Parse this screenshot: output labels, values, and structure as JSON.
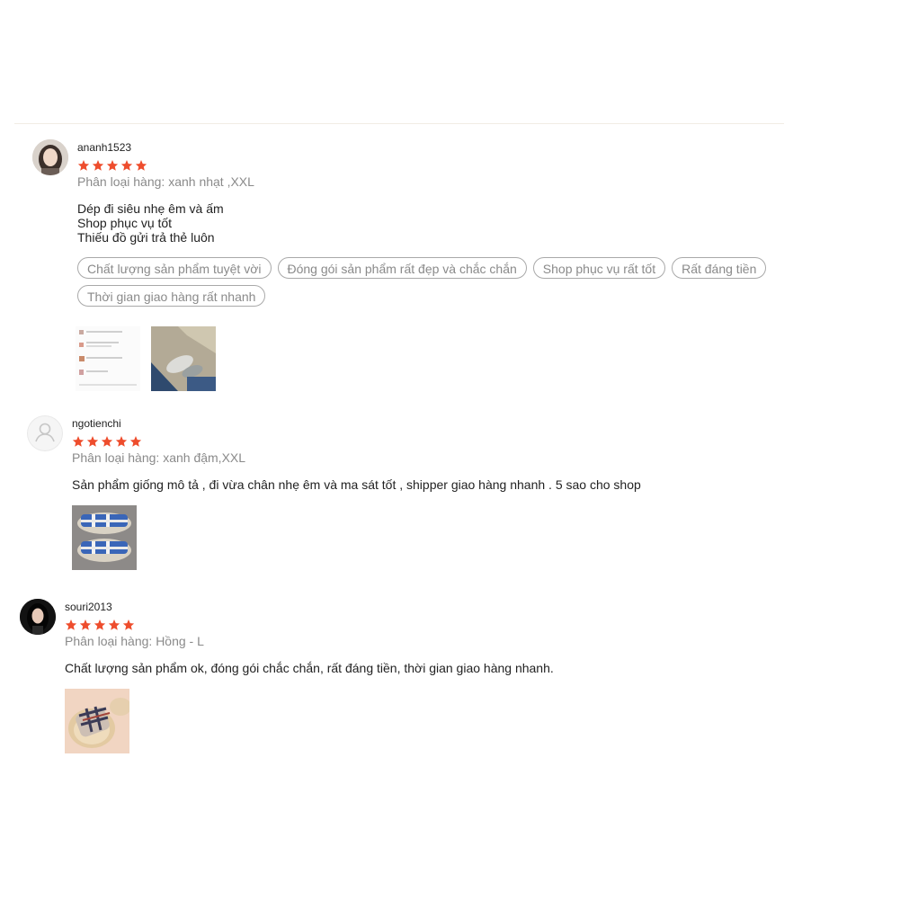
{
  "accent_color": "#ee4d2d",
  "reviews": [
    {
      "username": "ananh1523",
      "rating": 5,
      "variant": "Phân loại hàng: xanh nhạt ,XXL",
      "comment_lines": [
        "Dép đi siêu nhẹ êm và ấm",
        "Shop phục vụ tốt",
        "Thiếu đồ gửi trả thẻ luôn"
      ],
      "tags": [
        "Chất lượng sản phẩm tuyệt vời",
        "Đóng gói sản phẩm rất đẹp và chắc chắn",
        "Shop phục vụ rất tốt",
        "Rất đáng tiền",
        "Thời gian giao hàng rất nhanh"
      ]
    },
    {
      "username": "ngotienchi",
      "rating": 5,
      "variant": "Phân loại hàng: xanh đậm,XXL",
      "comment_lines": [
        "Sản phẩm giống mô tả , đi vừa chân nhẹ êm và ma sát tốt , shipper giao hàng nhanh . 5 sao cho shop"
      ]
    },
    {
      "username": "souri2013",
      "rating": 5,
      "variant": "Phân loại hàng: Hồng - L",
      "comment_lines": [
        "Chất lượng sản phẩm ok, đóng gói chắc chắn, rất đáng tiền, thời gian giao hàng nhanh."
      ]
    }
  ]
}
